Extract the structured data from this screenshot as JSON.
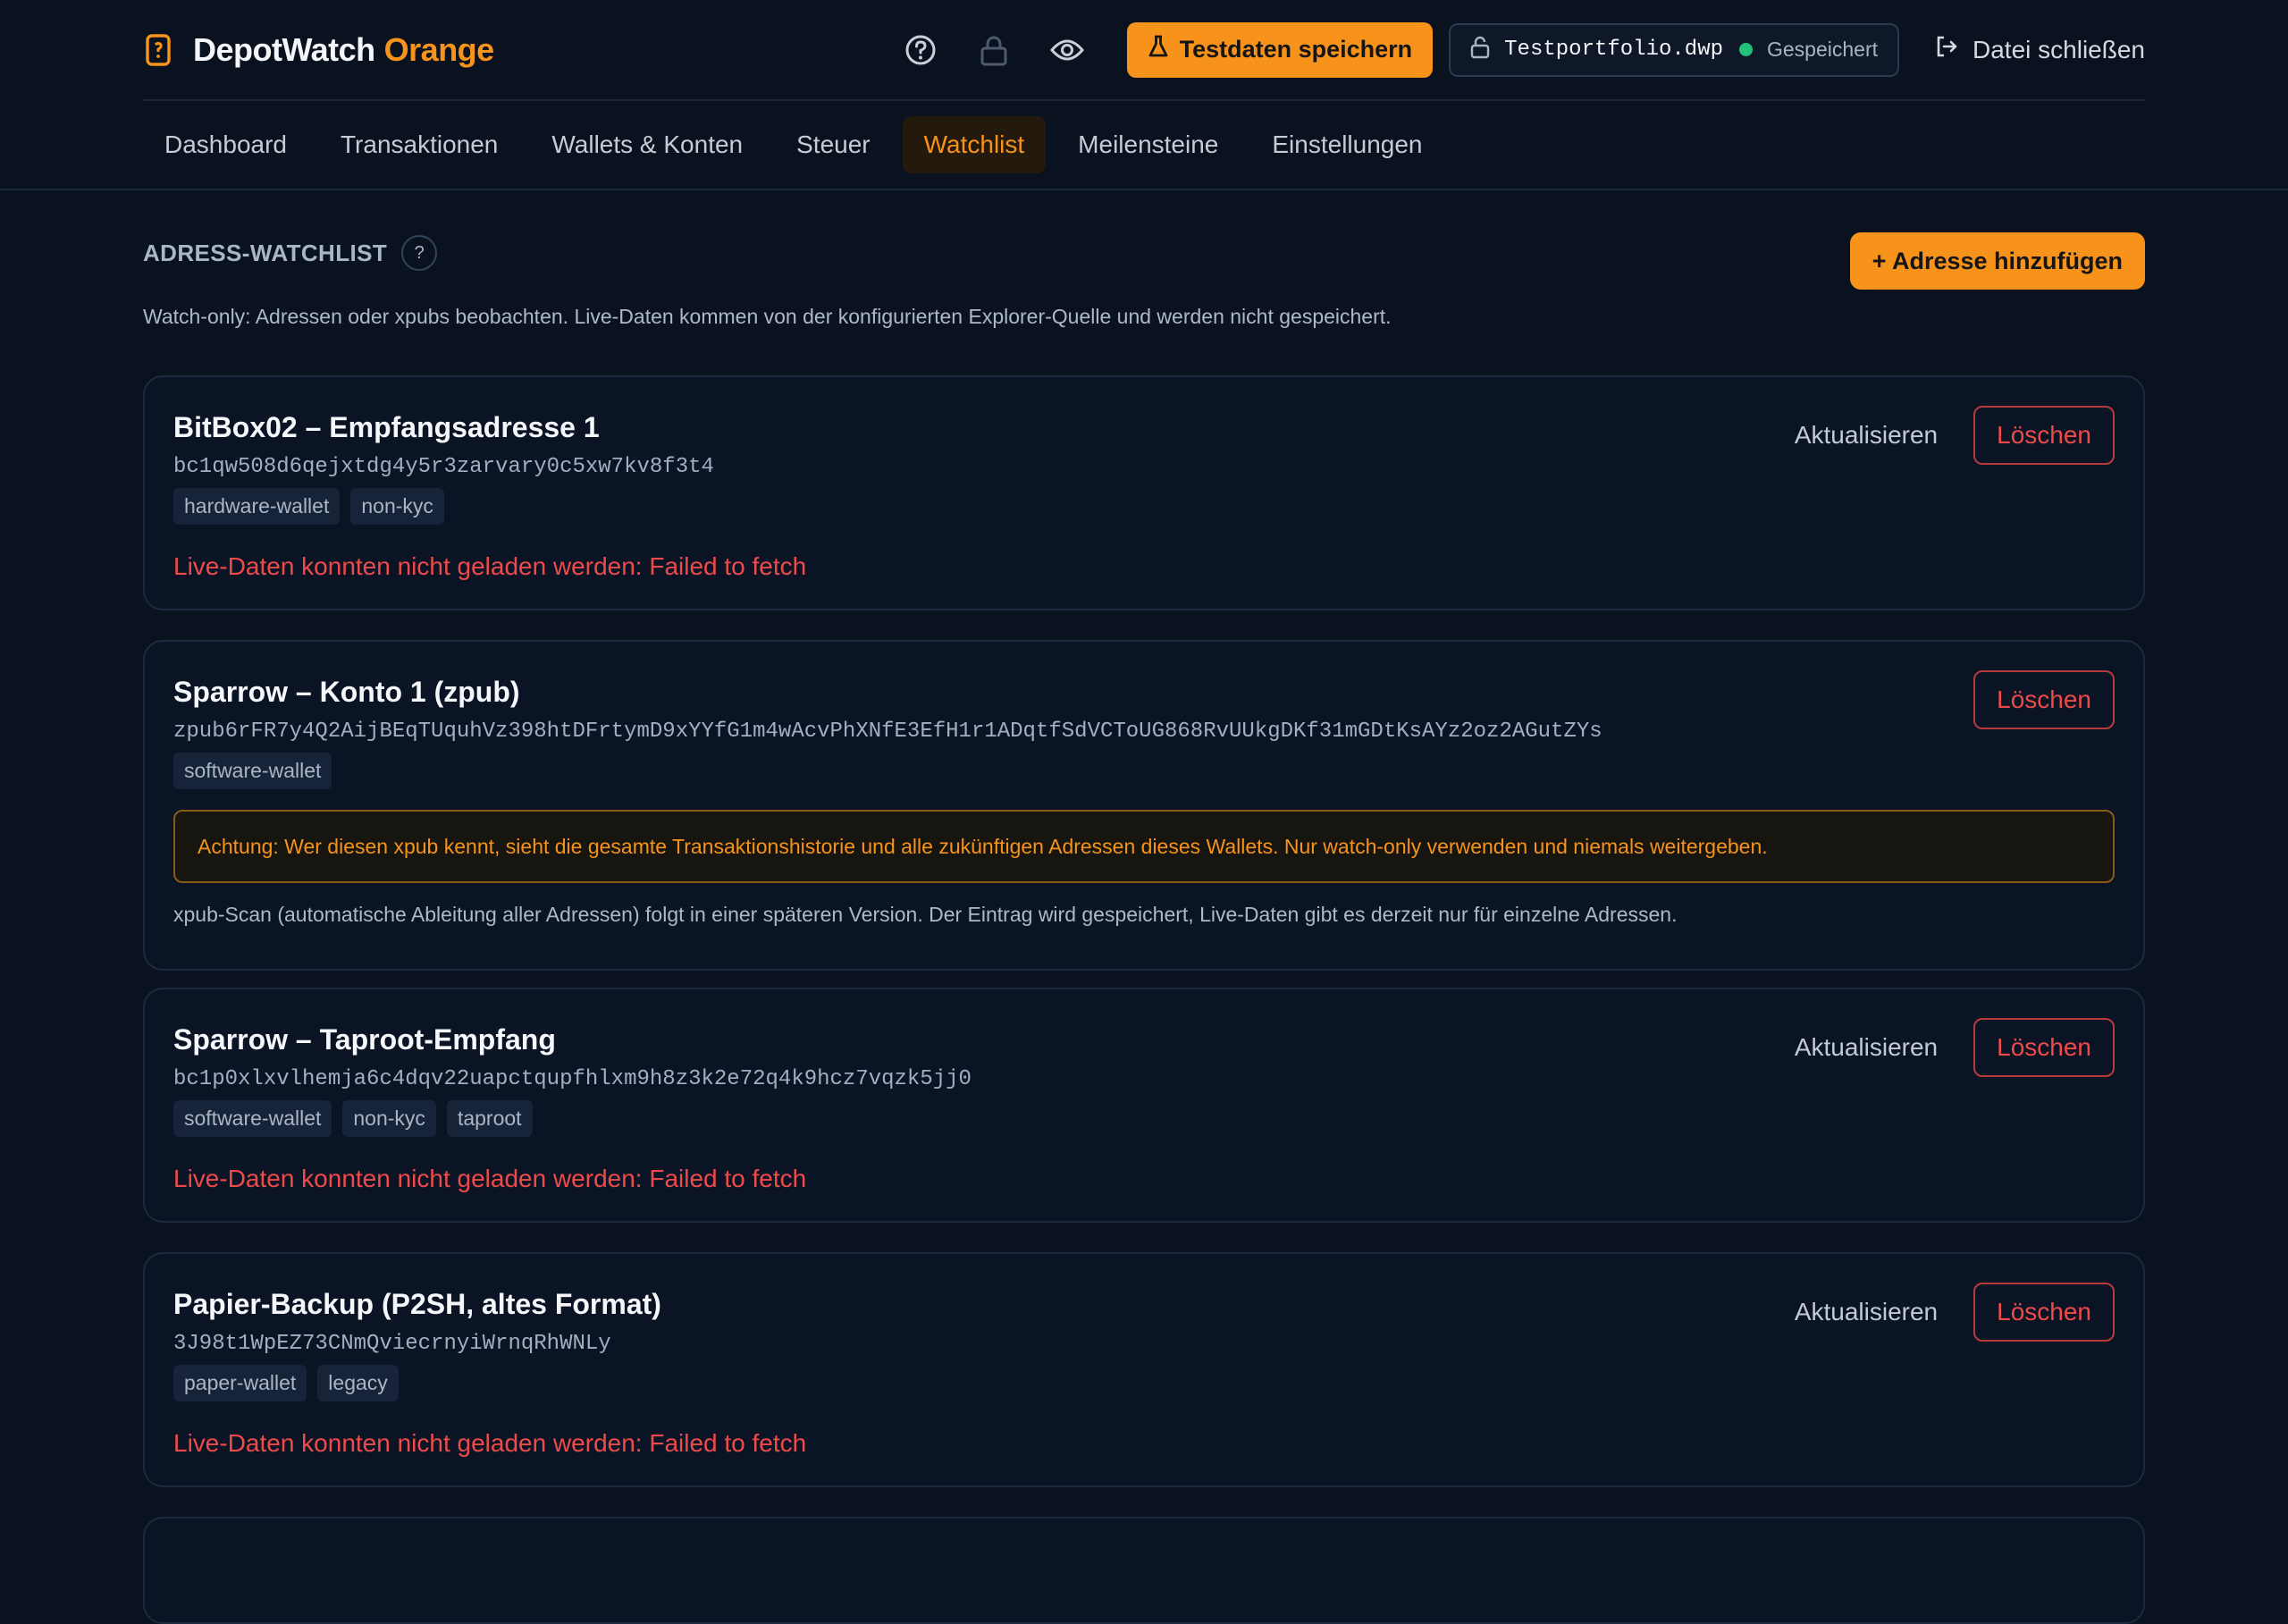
{
  "app": {
    "brand_name": "DepotWatch",
    "brand_accent": "Orange",
    "primary_action": "Testdaten speichern",
    "file_name": "Testportfolio.dwp",
    "file_status": "Gespeichert",
    "close_file": "Datei schließen"
  },
  "nav": {
    "items": [
      {
        "label": "Dashboard"
      },
      {
        "label": "Transaktionen"
      },
      {
        "label": "Wallets & Konten"
      },
      {
        "label": "Steuer"
      },
      {
        "label": "Watchlist",
        "active": true
      },
      {
        "label": "Meilensteine"
      },
      {
        "label": "Einstellungen"
      }
    ]
  },
  "watchlist": {
    "title": "ADRESS-WATCHLIST",
    "help": "?",
    "add_button": "+ Adresse hinzufügen",
    "subtitle": "Watch-only: Adressen oder xpubs beobachten. Live-Daten kommen von der konfigurierten Explorer-Quelle und werden nicht gespeichert.",
    "refresh_label": "Aktualisieren",
    "delete_label": "Löschen",
    "entries": [
      {
        "title": "BitBox02 – Empfangsadresse 1",
        "address": "bc1qw508d6qejxtdg4y5r3zarvary0c5xw7kv8f3t4",
        "tags": [
          "hardware-wallet",
          "non-kyc"
        ],
        "error": "Live-Daten konnten nicht geladen werden: Failed to fetch"
      },
      {
        "title": "Sparrow – Konto 1 (zpub)",
        "address": "zpub6rFR7y4Q2AijBEqTUquhVz398htDFrtymD9xYYfG1m4wAcvPhXNfE3EfH1r1ADqtfSdVCToUG868RvUUkgDKf31mGDtKsAYz2oz2AGutZYs",
        "tags": [
          "software-wallet"
        ],
        "warning": "Achtung: Wer diesen xpub kennt, sieht die gesamte Transaktionshistorie und alle zukünftigen Adressen dieses Wallets. Nur watch-only verwenden und niemals weitergeben.",
        "note": "xpub-Scan (automatische Ableitung aller Adressen) folgt in einer späteren Version. Der Eintrag wird gespeichert, Live-Daten gibt es derzeit nur für einzelne Adressen."
      },
      {
        "title": "Sparrow – Taproot-Empfang",
        "address": "bc1p0xlxvlhemja6c4dqv22uapctqupfhlxm9h8z3k2e72q4k9hcz7vqzk5jj0",
        "tags": [
          "software-wallet",
          "non-kyc",
          "taproot"
        ],
        "error": "Live-Daten konnten nicht geladen werden: Failed to fetch"
      },
      {
        "title": "Papier-Backup (P2SH, altes Format)",
        "address": "3J98t1WpEZ73CNmQviecrnyiWrnqRhWNLy",
        "tags": [
          "paper-wallet",
          "legacy"
        ],
        "error": "Live-Daten konnten nicht geladen werden: Failed to fetch"
      }
    ]
  },
  "colors": {
    "accent": "#f7931a",
    "background": "#0a1220",
    "error": "#ef4a4a",
    "success": "#22c07a"
  },
  "icons": [
    "wallet-icon",
    "help-circle-icon",
    "lock-icon",
    "eye-icon",
    "flask-icon",
    "lock-open-icon",
    "logout-icon"
  ]
}
